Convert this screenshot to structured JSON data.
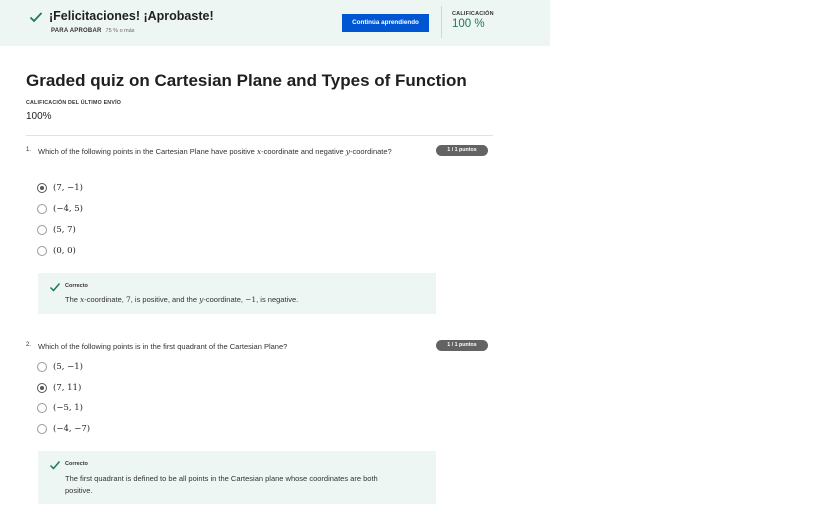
{
  "banner": {
    "title": "¡Felicitaciones! ¡Aprobaste!",
    "pass_label": "PARA APROBAR",
    "pass_value": "75 % o más",
    "cta_label": "Continúa aprendiendo",
    "grade_label": "CALIFICACIÓN",
    "grade_value": "100 %",
    "icon": "check-icon",
    "accent_color": "#1a7a5a",
    "button_color": "#0056d2"
  },
  "page": {
    "title": "Graded quiz on Cartesian Plane and Types of Function",
    "last_submission_label": "CALIFICACIÓN DEL ÚLTIMO ENVÍO",
    "last_submission_value": "100%"
  },
  "questions": [
    {
      "number": "1.",
      "text_1": "Which of the following points in the Cartesian Plane have positive ",
      "var_1": "x",
      "text_2": "-coordinate and negative ",
      "var_2": "y",
      "text_3": "-coordinate?",
      "points": "1 / 1 puntos",
      "options": [
        "(7, −1)",
        "(−4, 5)",
        "(5, 7)",
        "(0, 0)"
      ],
      "selected": 0,
      "feedback_label": "Correcto",
      "feedback": {
        "p1": "The ",
        "v1": "x",
        "p2": "-coordinate, ",
        "n1": "7",
        "p3": ", is positive, and the ",
        "v2": "y",
        "p4": "-coordinate, ",
        "n2": "−1",
        "p5": ", is negative."
      }
    },
    {
      "number": "2.",
      "text": "Which of the following points is in the first quadrant of the Cartesian Plane?",
      "points": "1 / 1 puntos",
      "options": [
        "(5, −1)",
        "(7, 11)",
        "(−5, 1)",
        "(−4, −7)"
      ],
      "selected": 1,
      "feedback_label": "Correcto",
      "feedback_line_1": "The first quadrant is defined to be all points in the Cartesian plane whose coordinates are both",
      "feedback_line_2": "positive."
    }
  ]
}
